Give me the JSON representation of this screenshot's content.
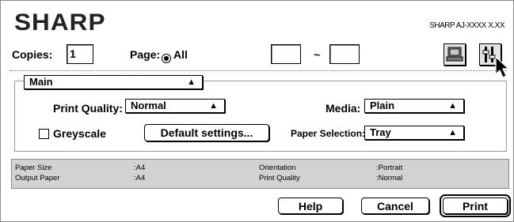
{
  "brand": "SHARP",
  "model_name": "SHARP AJ-XXXX X.XX",
  "copies": {
    "label": "Copies:",
    "value": "1"
  },
  "page": {
    "label": "Page:",
    "all_label": "All",
    "range_separator": "~",
    "from_value": "",
    "to_value": ""
  },
  "icons": {
    "printer_icon": "printer-icon",
    "settings_icon": "settings-icon",
    "cursor": "cursor-icon"
  },
  "tab_select": {
    "value": "Main"
  },
  "print_quality": {
    "label": "Print Quality:",
    "value": "Normal"
  },
  "media": {
    "label": "Media:",
    "value": "Plain"
  },
  "greyscale": {
    "label": "Greyscale",
    "checked": false
  },
  "default_settings_button": "Default settings...",
  "paper_selection": {
    "label": "Paper Selection:",
    "value": "Tray"
  },
  "summary": {
    "paper_size_label": "Paper Size",
    "paper_size_value": ":A4",
    "output_paper_label": "Output Paper",
    "output_paper_value": ":A4",
    "orientation_label": "Orientation",
    "orientation_value": ":Portrait",
    "print_quality_label": "Print Quality",
    "print_quality_value": ":Normal"
  },
  "buttons": {
    "help": "Help",
    "cancel": "Cancel",
    "print": "Print"
  }
}
